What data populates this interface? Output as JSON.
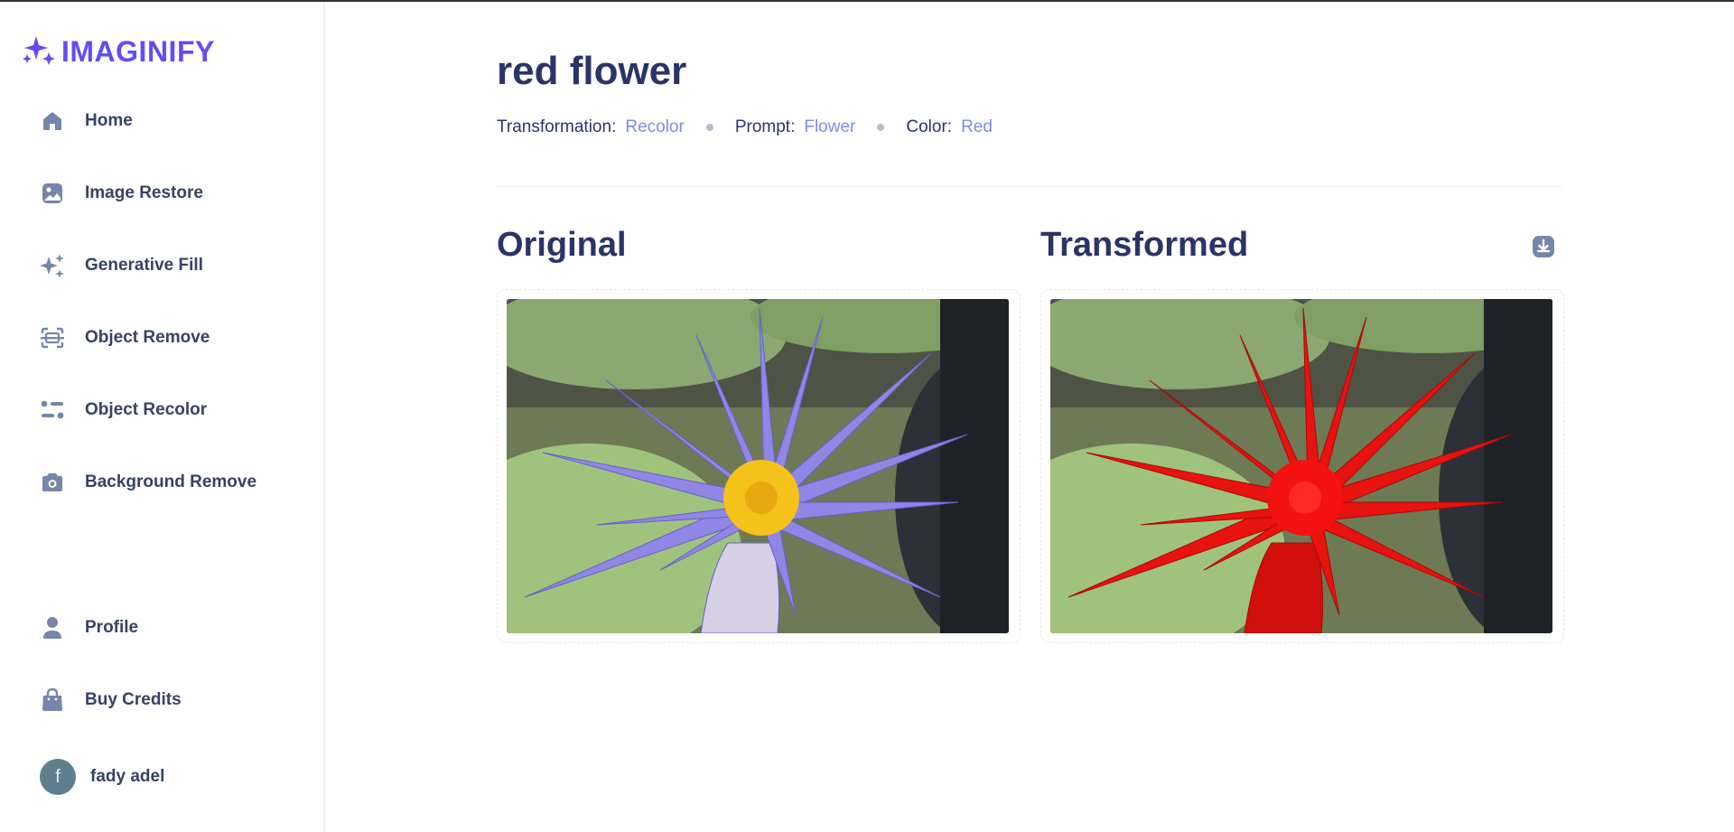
{
  "app": {
    "name": "IMAGINIFY"
  },
  "nav": {
    "items": [
      {
        "label": "Home",
        "icon": "home-icon"
      },
      {
        "label": "Image Restore",
        "icon": "image-icon"
      },
      {
        "label": "Generative Fill",
        "icon": "stars-icon"
      },
      {
        "label": "Object Remove",
        "icon": "scan-icon"
      },
      {
        "label": "Object Recolor",
        "icon": "filter-icon"
      },
      {
        "label": "Background Remove",
        "icon": "camera-icon"
      }
    ],
    "bottom": [
      {
        "label": "Profile",
        "icon": "profile-icon"
      },
      {
        "label": "Buy Credits",
        "icon": "bag-icon"
      }
    ]
  },
  "user": {
    "initial": "f",
    "name": "fady adel"
  },
  "page": {
    "title": "red flower",
    "meta": {
      "transformation_label": "Transformation:",
      "transformation_value": "Recolor",
      "prompt_label": "Prompt:",
      "prompt_value": "Flower",
      "color_label": "Color:",
      "color_value": "Red"
    },
    "original_heading": "Original",
    "transformed_heading": "Transformed"
  },
  "colors": {
    "brand": "#624cf5",
    "heading": "#2b3467",
    "accent_text": "#7c8ce8",
    "icon": "#7686aa",
    "original_petal": "#8f86e6",
    "transformed_petal": "#e8120f"
  }
}
